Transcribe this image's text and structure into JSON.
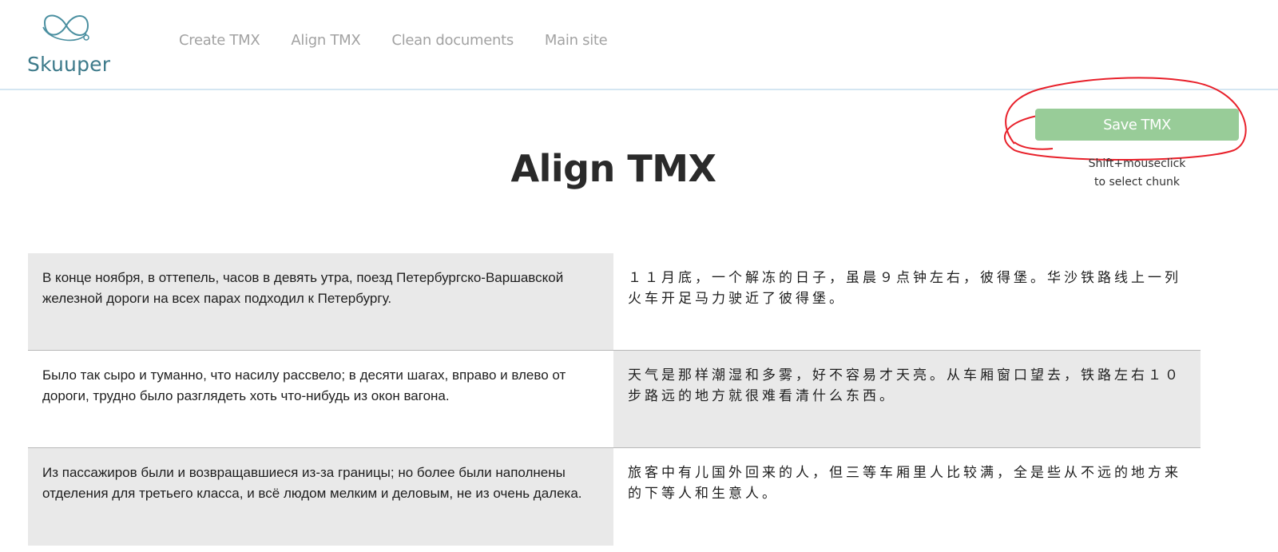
{
  "header": {
    "logo_text": "Skuuper",
    "nav": [
      "Create TMX",
      "Align TMX",
      "Clean documents",
      "Main site"
    ]
  },
  "actions": {
    "save_label": "Save TMX",
    "hint_line1": "Shift+mouseclick",
    "hint_line2": "to select chunk"
  },
  "page": {
    "title": "Align TMX"
  },
  "alignment": {
    "rows": [
      {
        "source": "В конце ноября, в оттепель, часов в девять утра, поезд Петербургско-Варшавской железной дороги на всех парах подходил к Петербургу.",
        "target": "１１月底，一个解冻的日子，虽晨９点钟左右，彼得堡。华沙铁路线上一列火车开足马力驶近了彼得堡。"
      },
      {
        "source": "Было так сыро и туманно, что насилу рассвело; в десяти шагах, вправо и влево от дороги, трудно было разглядеть хоть что-нибудь из окон вагона.",
        "target": "天气是那样潮湿和多雾，好不容易才天亮。从车厢窗口望去，铁路左右１０步路远的地方就很难看清什么东西。"
      },
      {
        "source": "Из пассажиров были и возвращавшиеся из-за границы; но более были наполнены отделения для третьего класса, и всё людом мелким и деловым, не из очень далека.",
        "target": "旅客中有儿国外回来的人，但三等车厢里人比较满，全是些从不远的地方来的下等人和生意人。"
      }
    ]
  },
  "colors": {
    "save_button": "#98cc98",
    "annotation": "#e8202a",
    "row_grey": "#e9e9e9"
  }
}
